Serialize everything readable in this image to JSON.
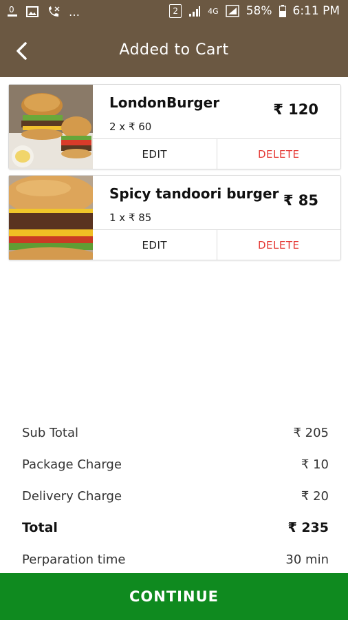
{
  "status_bar": {
    "sim_badge": "2",
    "network": "4G",
    "battery": "58%",
    "time": "6:11 PM",
    "icons": [
      "data-usage-icon",
      "image-icon",
      "missed-call-icon",
      "more-dots-icon",
      "sim-icon",
      "signal-icon",
      "battery-icon"
    ]
  },
  "app_bar": {
    "title": "Added to Cart",
    "back_icon": "back-arrow-icon",
    "bg_color": "#6b5842"
  },
  "cart": {
    "items": [
      {
        "name": "LondonBurger",
        "qty_text": "2 x  ₹ 60",
        "price": "₹ 120",
        "edit_label": "EDIT",
        "delete_label": "DELETE"
      },
      {
        "name": "Spicy tandoori burger",
        "qty_text": "1 x  ₹ 85",
        "price": "₹ 85",
        "edit_label": "EDIT",
        "delete_label": "DELETE"
      }
    ]
  },
  "summary": {
    "rows": [
      {
        "label": "Sub Total",
        "value": "₹ 205"
      },
      {
        "label": "Package Charge",
        "value": "₹ 10"
      },
      {
        "label": "Delivery Charge",
        "value": "₹ 20"
      },
      {
        "label": "Total",
        "value": "₹ 235"
      },
      {
        "label": "Perparation time",
        "value": "30 min"
      }
    ]
  },
  "footer": {
    "continue_label": "CONTINUE",
    "bg_color": "#0f8a1f"
  },
  "colors": {
    "delete": "#e53935"
  }
}
